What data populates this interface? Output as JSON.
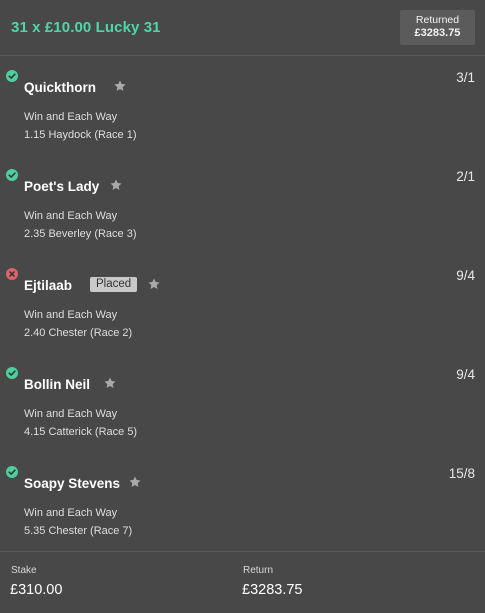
{
  "header": {
    "bet_title": "31 x £10.00 Lucky 31",
    "returned_label": "Returned",
    "returned_amount": "£3283.75"
  },
  "selections": [
    {
      "name": "Quickthorn",
      "status": "won",
      "badge": "",
      "odds": "3/1",
      "bet_type": "Win and Each Way",
      "race": "1.15 Haydock (Race 1)"
    },
    {
      "name": "Poet's Lady",
      "status": "won",
      "badge": "",
      "odds": "2/1",
      "bet_type": "Win and Each Way",
      "race": "2.35 Beverley (Race 3)"
    },
    {
      "name": "Ejtilaab",
      "status": "lost",
      "badge": "Placed",
      "odds": "9/4",
      "bet_type": "Win and Each Way",
      "race": "2.40 Chester (Race 2)"
    },
    {
      "name": "Bollin Neil",
      "status": "won",
      "badge": "",
      "odds": "9/4",
      "bet_type": "Win and Each Way",
      "race": "4.15 Catterick (Race 5)"
    },
    {
      "name": "Soapy Stevens",
      "status": "won",
      "badge": "",
      "odds": "15/8",
      "bet_type": "Win and Each Way",
      "race": "5.35 Chester (Race 7)"
    }
  ],
  "footer": {
    "stake_label": "Stake",
    "stake_value": "£310.00",
    "return_label": "Return",
    "return_value": "£3283.75"
  },
  "colors": {
    "background": "#484848",
    "accent": "#4fd6a8",
    "won": "#4fcf9e",
    "lost": "#d9646a"
  },
  "icons": {
    "won": "check-circle-icon",
    "lost": "cross-circle-icon",
    "favourite": "star-icon"
  }
}
